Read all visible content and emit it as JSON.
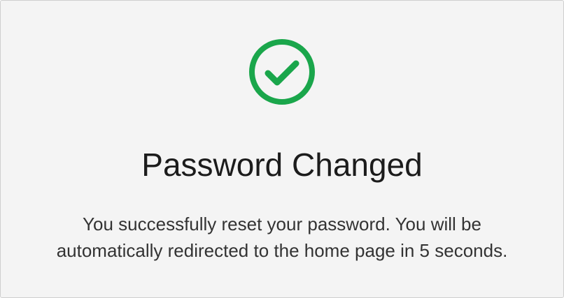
{
  "dialog": {
    "icon": "check-circle-icon",
    "accent_color": "#1aa64b",
    "title": "Password Changed",
    "message_line_1": "You successfully reset your password. You will be",
    "message_line_2": "automatically redirected to the home page in 5 seconds."
  }
}
